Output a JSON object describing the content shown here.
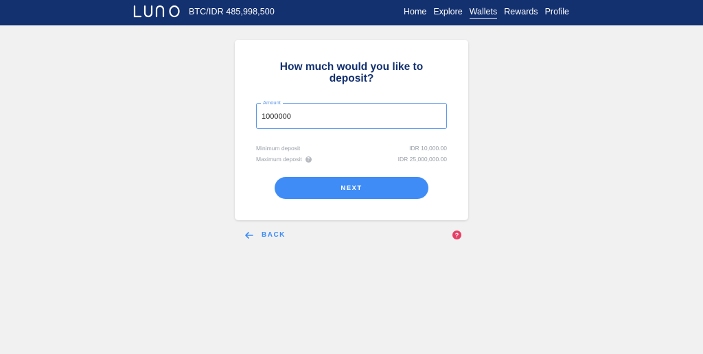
{
  "header": {
    "logo_text": "LUNO",
    "ticker": "BTC/IDR 485,998,500",
    "nav": [
      {
        "label": "Home",
        "active": false
      },
      {
        "label": "Explore",
        "active": false
      },
      {
        "label": "Wallets",
        "active": true
      },
      {
        "label": "Rewards",
        "active": false
      },
      {
        "label": "Profile",
        "active": false
      }
    ]
  },
  "deposit": {
    "title": "How much would you like to deposit?",
    "amount_label": "Amount",
    "amount_value": "1000000",
    "min_label": "Minimum deposit",
    "min_value": "IDR 10,000.00",
    "max_label": "Maximum deposit",
    "max_value": "IDR 25,000,000.00",
    "help_glyph": "?",
    "next_label": "NEXT"
  },
  "footer": {
    "back_label": "BACK",
    "help_glyph": "?"
  },
  "colors": {
    "navbar": "#13306f",
    "primary": "#3f8cf7",
    "help": "#e63f66",
    "background": "#f1f1f1"
  },
  "icons": {
    "logo": "luno-logo",
    "back": "arrow-left-icon",
    "info": "question-circle-icon",
    "help": "help-icon"
  }
}
